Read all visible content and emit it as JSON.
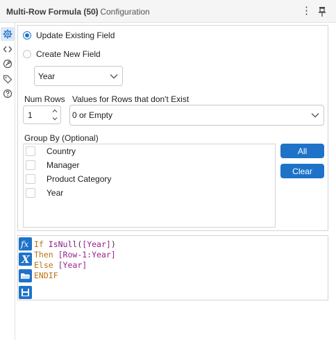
{
  "header": {
    "title": "Multi-Row Formula (50)",
    "subtitle": "- Configuration",
    "menu_icon": "⋮",
    "pin_icon": "pin-icon"
  },
  "sidebar": {
    "icons": [
      "gear-icon",
      "code-icon",
      "tool-icon",
      "tag-icon",
      "help-icon"
    ]
  },
  "config": {
    "update_existing": {
      "label": "Update Existing Field",
      "selected": true
    },
    "create_new": {
      "label": "Create New  Field",
      "selected": false
    },
    "field_select": {
      "value": "Year"
    },
    "num_rows": {
      "label": "Num Rows",
      "value": "1"
    },
    "values_for_rows": {
      "label": "Values for Rows that don't Exist",
      "value": "0 or Empty"
    },
    "group_by": {
      "label": "Group By (Optional)",
      "items": [
        {
          "label": "Country",
          "checked": false
        },
        {
          "label": "Manager",
          "checked": false
        },
        {
          "label": "Product Category",
          "checked": false
        },
        {
          "label": "Year",
          "checked": false
        }
      ],
      "all_button": "All",
      "clear_button": "Clear"
    }
  },
  "formula": {
    "icons": [
      "fx-icon",
      "variable-icon",
      "open-folder-icon",
      "save-icon"
    ],
    "lines": [
      [
        [
          "If ",
          "kw"
        ],
        [
          "IsNull",
          "fn"
        ],
        [
          "(",
          "pn"
        ],
        [
          "[Year]",
          "fld"
        ],
        [
          ")",
          "pn"
        ]
      ],
      [
        [
          "Then ",
          "kw"
        ],
        [
          "[Row-1:Year]",
          "fld"
        ]
      ],
      [
        [
          "Else ",
          "kw"
        ],
        [
          "[Year]",
          "fld"
        ]
      ],
      [
        [
          "ENDIF",
          "kw"
        ]
      ]
    ]
  },
  "colors": {
    "accent": "#1e73c9",
    "keyword": "#c07012",
    "field": "#9a2090"
  }
}
